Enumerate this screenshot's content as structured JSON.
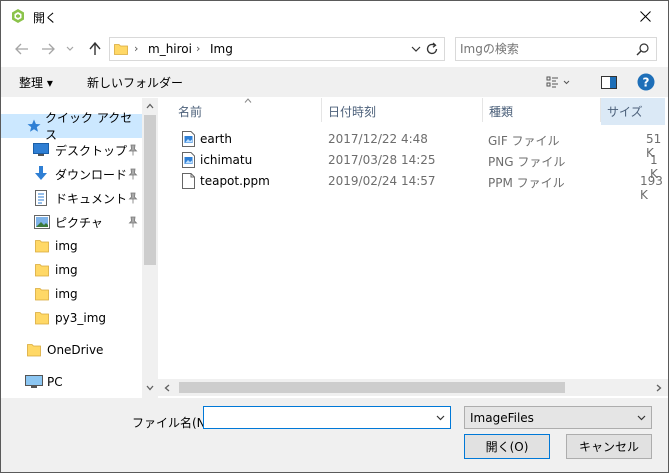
{
  "window": {
    "title": "開く"
  },
  "address": {
    "crumbs": [
      "m_hiroi",
      "Img"
    ],
    "separator": "›"
  },
  "search": {
    "placeholder": "Imgの検索"
  },
  "toolbar": {
    "organize": "整理 ▾",
    "new_folder": "新しいフォルダー"
  },
  "nav": {
    "items": [
      {
        "label": "クイック アクセス",
        "icon": "star-icon",
        "selected": true
      },
      {
        "label": "デスクトップ",
        "icon": "desktop-icon",
        "pinned": true
      },
      {
        "label": "ダウンロード",
        "icon": "download-icon",
        "pinned": true
      },
      {
        "label": "ドキュメント",
        "icon": "document-icon",
        "pinned": true
      },
      {
        "label": "ピクチャ",
        "icon": "pictures-icon",
        "pinned": true
      },
      {
        "label": "img",
        "icon": "folder-icon"
      },
      {
        "label": "img",
        "icon": "folder-icon"
      },
      {
        "label": "img",
        "icon": "folder-icon"
      },
      {
        "label": "py3_img",
        "icon": "folder-icon"
      },
      {
        "label": "OneDrive",
        "icon": "folder-icon"
      },
      {
        "label": "PC",
        "icon": "pc-icon"
      }
    ]
  },
  "columns": {
    "name": "名前",
    "date": "日付時刻",
    "type": "種類",
    "size": "サイズ"
  },
  "files": [
    {
      "name": "earth",
      "date": "2017/12/22 4:48",
      "type": "GIF ファイル",
      "size": "51 K",
      "icon": "image-file-icon"
    },
    {
      "name": "ichimatu",
      "date": "2017/03/28 14:25",
      "type": "PNG ファイル",
      "size": "1 K",
      "icon": "image-file-icon"
    },
    {
      "name": "teapot.ppm",
      "date": "2019/02/24 14:57",
      "type": "PPM ファイル",
      "size": "193 K",
      "icon": "blank-file-icon"
    }
  ],
  "bottom": {
    "filename_label": "ファイル名(N):",
    "filename_value": "",
    "filetype_value": "ImageFiles",
    "open_button": "開く(O)",
    "cancel_button": "キャンセル"
  },
  "colors": {
    "accent": "#0078d7",
    "selection": "#cce8ff",
    "folder": "#ffd866"
  }
}
